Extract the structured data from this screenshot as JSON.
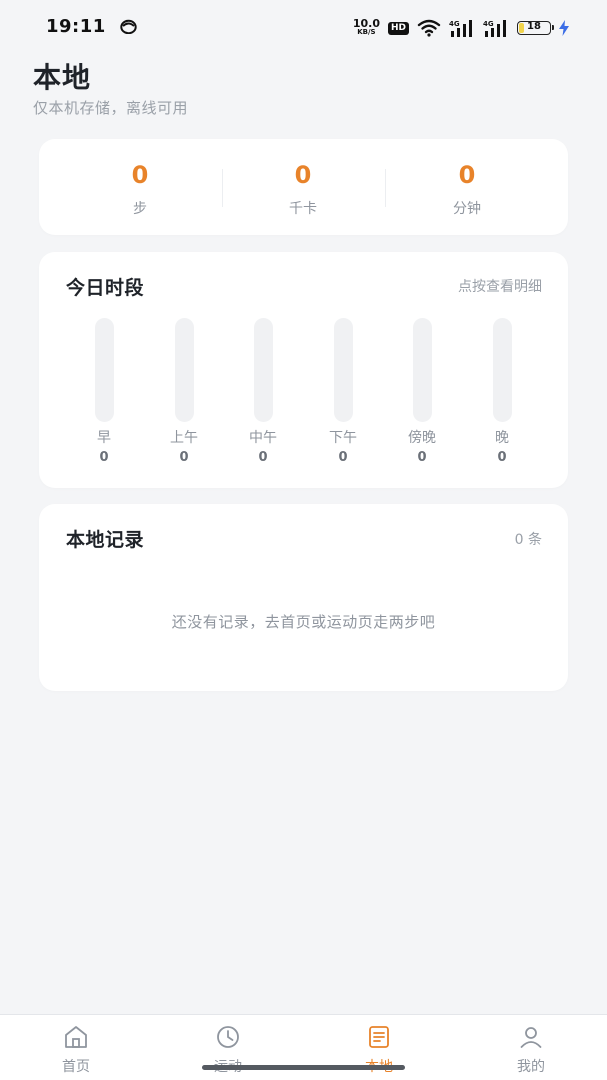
{
  "status_bar": {
    "time": "19:11",
    "net_speed_value": "10.0",
    "net_speed_unit": "KB/S",
    "hd_label": "HD",
    "signal_1_label": "4G",
    "signal_2_label": "4G",
    "battery_level": "18",
    "battery_fraction": 0.18
  },
  "header": {
    "title": "本地",
    "subtitle": "仅本机存储，离线可用"
  },
  "stats": [
    {
      "value": "0",
      "label": "步"
    },
    {
      "value": "0",
      "label": "千卡"
    },
    {
      "value": "0",
      "label": "分钟"
    }
  ],
  "periods_card": {
    "title": "今日时段",
    "hint": "点按查看明细",
    "periods": [
      {
        "label": "早",
        "value": "0",
        "fill": 0
      },
      {
        "label": "上午",
        "value": "0",
        "fill": 0
      },
      {
        "label": "中午",
        "value": "0",
        "fill": 0
      },
      {
        "label": "下午",
        "value": "0",
        "fill": 0
      },
      {
        "label": "傍晚",
        "value": "0",
        "fill": 0
      },
      {
        "label": "晚",
        "value": "0",
        "fill": 0
      }
    ]
  },
  "records_card": {
    "title": "本地记录",
    "count": "0 条",
    "empty_text": "还没有记录，去首页或运动页走两步吧"
  },
  "bottom_nav": {
    "items": [
      {
        "label": "首页",
        "icon": "home-icon",
        "active": false
      },
      {
        "label": "运动",
        "icon": "clock-icon",
        "active": false
      },
      {
        "label": "本地",
        "icon": "document-icon",
        "active": true
      },
      {
        "label": "我的",
        "icon": "user-icon",
        "active": false
      }
    ]
  },
  "colors": {
    "accent": "#e8832a",
    "background": "#f4f5f7",
    "card": "#ffffff",
    "muted_text": "#8f959e",
    "battery_fill": "#f2d44b",
    "charging_bolt": "#3b6de6"
  }
}
